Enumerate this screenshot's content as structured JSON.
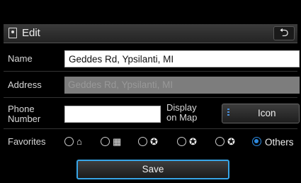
{
  "header": {
    "title": "Edit",
    "title_icon": "map-pin-icon",
    "back_icon": "back-arrow-icon",
    "back_glyph": "⮌"
  },
  "form": {
    "name": {
      "label": "Name",
      "value": "Geddes Rd, Ypsilanti, MI"
    },
    "address": {
      "label": "Address",
      "value": "Geddes Rd, Ypsilanti, MI"
    },
    "phone": {
      "label_line1": "Phone",
      "label_line2": "Number",
      "value": ""
    },
    "display_on_map": {
      "label_line1": "Display",
      "label_line2": "on Map",
      "button_label": "Icon"
    },
    "favorites": {
      "label": "Favorites",
      "options": [
        {
          "icon": "home-icon",
          "glyph": "⌂",
          "selected": false
        },
        {
          "icon": "office-building-icon",
          "glyph": "▦",
          "selected": false
        },
        {
          "icon": "favorite-pin-1-icon",
          "glyph": "✪",
          "selected": false
        },
        {
          "icon": "favorite-pin-2-icon",
          "glyph": "✪",
          "selected": false
        },
        {
          "icon": "favorite-pin-3-icon",
          "glyph": "✪",
          "selected": false
        },
        {
          "text": "Others",
          "selected": true
        }
      ]
    }
  },
  "footer": {
    "save_label": "Save"
  },
  "colors": {
    "accent": "#2d8ae0",
    "save_border": "#38a6e8",
    "background": "#000000",
    "disabled_field": "#7d7d7d"
  }
}
